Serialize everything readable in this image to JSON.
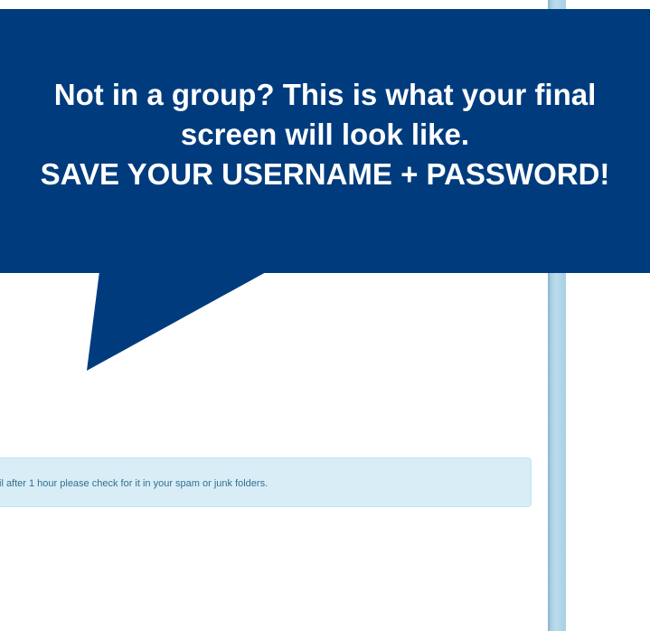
{
  "callout": {
    "line1": "Not in a group? This is what your final",
    "line2": "screen will look like.",
    "line3": "SAVE YOUR USERNAME + PASSWORD!"
  },
  "alert": {
    "text": "il after 1 hour please check for it in your spam or junk folders."
  },
  "colors": {
    "callout_background": "#003c7d",
    "callout_text": "#ffffff",
    "alert_background": "#d9edf7",
    "alert_border": "#bce8f1",
    "alert_text": "#31708f",
    "side_bar": "#a6cfe3"
  }
}
